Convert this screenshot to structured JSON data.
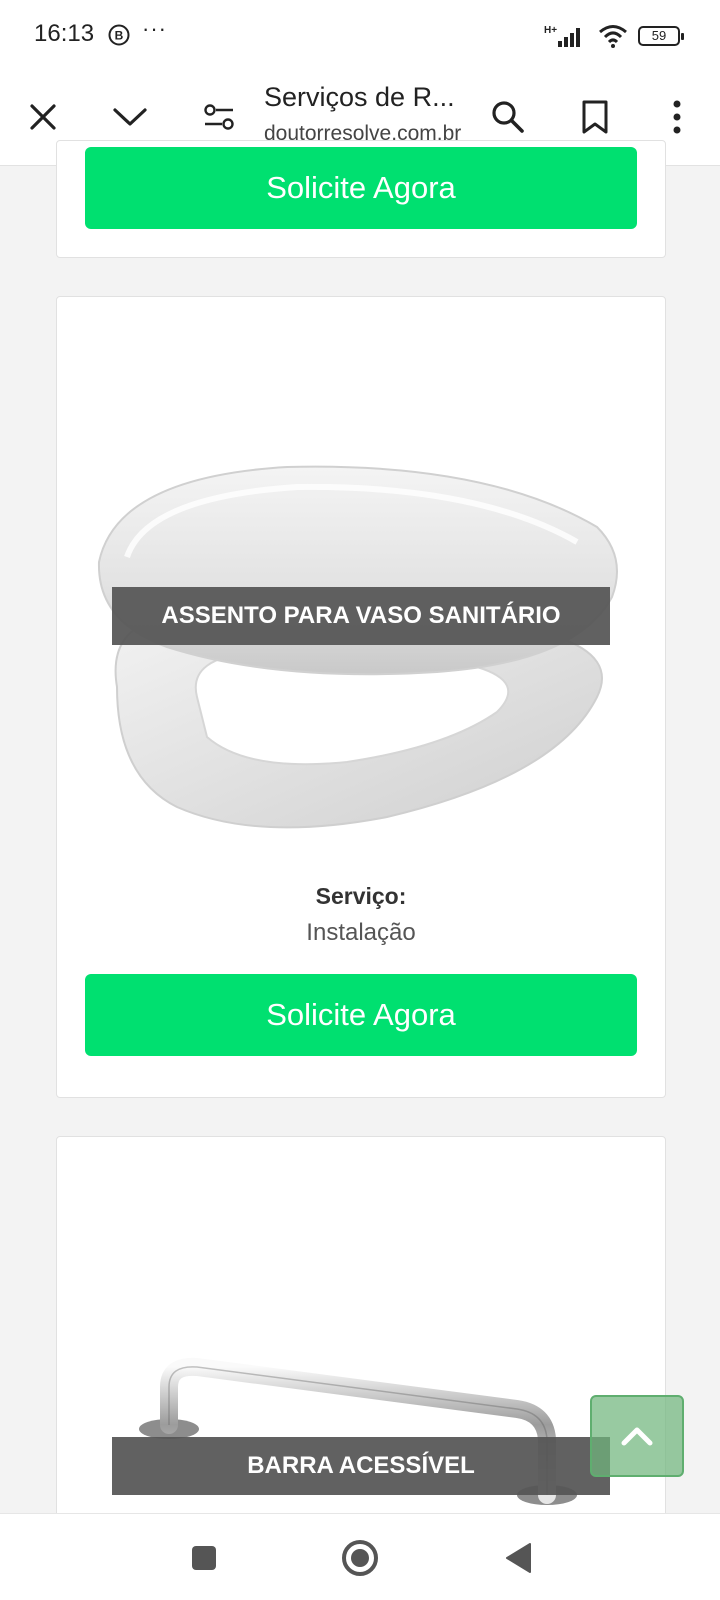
{
  "status_bar": {
    "time": "16:13",
    "b_icon_letter": "B",
    "dots": "···",
    "network": "H+",
    "battery": "59"
  },
  "toolbar": {
    "title": "Serviços de R...",
    "url": "doutorresolve.com.br"
  },
  "cards": [
    {
      "button_label": "Solicite Agora"
    },
    {
      "caption": "ASSENTO PARA VASO SANITÁRIO",
      "service_label": "Serviço:",
      "service_value": "Instalação",
      "button_label": "Solicite Agora"
    },
    {
      "caption": "BARRA ACESSÍVEL"
    }
  ],
  "colors": {
    "cta_green": "#00e070",
    "page_bg": "#f3f3f3",
    "caption_bg": "#555555",
    "scroll_top_bg": "#70b67d"
  },
  "icons": [
    "close-icon",
    "chevron-down-icon",
    "page-settings-icon",
    "search-icon",
    "bookmark-icon",
    "more-vert-icon",
    "arrow-up-icon",
    "nav-recents-icon",
    "nav-home-icon",
    "nav-back-icon"
  ]
}
